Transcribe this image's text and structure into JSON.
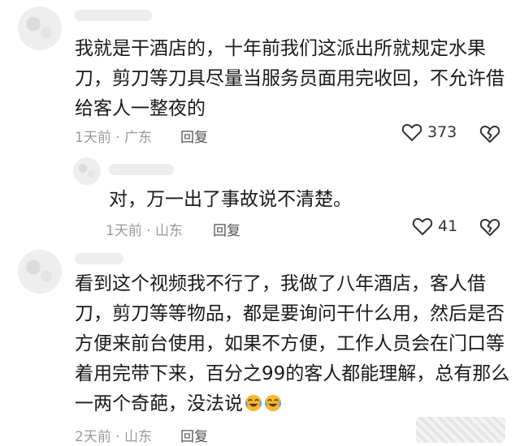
{
  "comments": [
    {
      "lines": [
        "我就是干酒店的，十年前我们这派出所就规定水果",
        "刀，剪刀等刀具尽量当服务员面用完收回，不允许借",
        "给客人一整夜的"
      ],
      "meta": "1天前 · 广东",
      "reply_label": "回复",
      "likes": "373"
    },
    {
      "lines": [
        "对，万一出了事故说不清楚。"
      ],
      "meta": "1天前 · 山东",
      "reply_label": "回复",
      "likes": "41"
    },
    {
      "lines": [
        "看到这个视频我不行了，我做了八年酒店，客人借",
        "刀，剪刀等等物品，都是要询问干什么用，然后是否",
        "方便来前台使用，如果不方便，工作人员会在门口等",
        "着用完带下来，百分之99的客人都能理解，总有那么",
        "一两个奇葩，没法说"
      ],
      "emojis": [
        "crying-laughing-emoji",
        "crying-laughing-emoji"
      ],
      "meta": "2天前 · 山东",
      "reply_label": "回复"
    }
  ],
  "icons": {
    "like": "heart-outline-icon",
    "dislike": "broken-heart-icon"
  },
  "colors": {
    "text": "#1a1a1a",
    "meta": "#9a9a9a",
    "emoji": "#f7b731"
  }
}
